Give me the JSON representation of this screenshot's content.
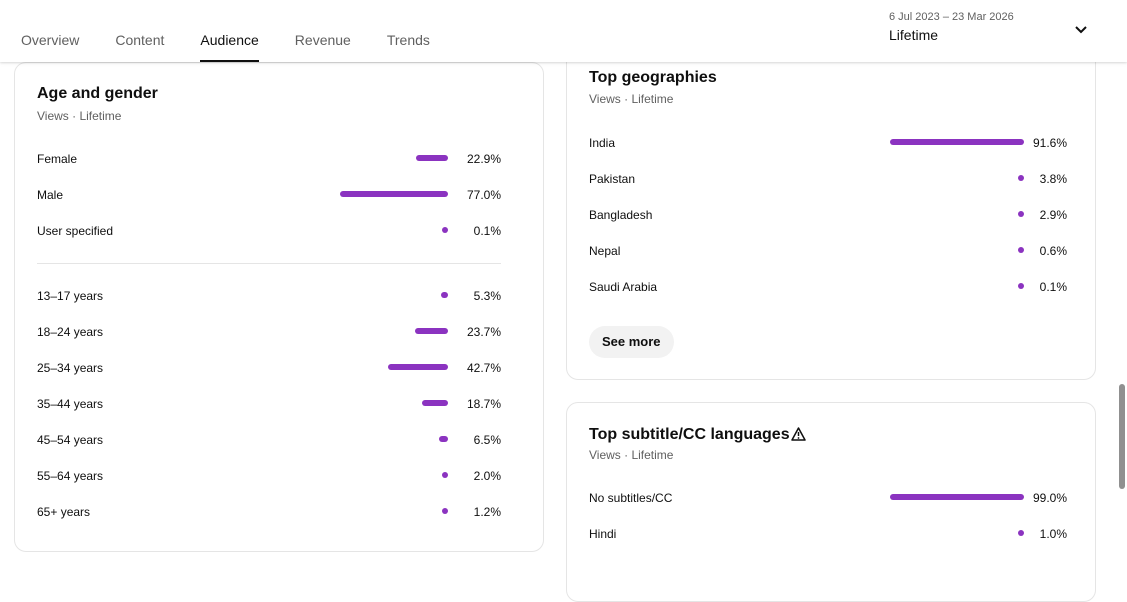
{
  "tabs": [
    {
      "label": "Overview"
    },
    {
      "label": "Content"
    },
    {
      "label": "Audience"
    },
    {
      "label": "Revenue"
    },
    {
      "label": "Trends"
    }
  ],
  "active_tab": "Audience",
  "date_range": {
    "range": "6 Jul 2023 – 23 Mar 2026",
    "period": "Lifetime"
  },
  "colors": {
    "bar": "#8b33c0"
  },
  "age_gender": {
    "title": "Age and gender",
    "subtitle": "Views · Lifetime",
    "gender": [
      {
        "label": "Female",
        "value": "22.9%",
        "pct": 22.9
      },
      {
        "label": "Male",
        "value": "77.0%",
        "pct": 77.0
      },
      {
        "label": "User specified",
        "value": "0.1%",
        "pct": 0.1
      }
    ],
    "ages": [
      {
        "label": "13–17 years",
        "value": "5.3%",
        "pct": 5.3
      },
      {
        "label": "18–24 years",
        "value": "23.7%",
        "pct": 23.7
      },
      {
        "label": "25–34 years",
        "value": "42.7%",
        "pct": 42.7
      },
      {
        "label": "35–44 years",
        "value": "18.7%",
        "pct": 18.7
      },
      {
        "label": "45–54 years",
        "value": "6.5%",
        "pct": 6.5
      },
      {
        "label": "55–64 years",
        "value": "2.0%",
        "pct": 2.0
      },
      {
        "label": "65+ years",
        "value": "1.2%",
        "pct": 1.2
      }
    ]
  },
  "geographies": {
    "title": "Top geographies",
    "subtitle": "Views · Lifetime",
    "rows": [
      {
        "label": "India",
        "value": "91.6%",
        "pct": 91.6
      },
      {
        "label": "Pakistan",
        "value": "3.8%",
        "pct": 3.8
      },
      {
        "label": "Bangladesh",
        "value": "2.9%",
        "pct": 2.9
      },
      {
        "label": "Nepal",
        "value": "0.6%",
        "pct": 0.6
      },
      {
        "label": "Saudi Arabia",
        "value": "0.1%",
        "pct": 0.1
      }
    ],
    "see_more": "See more"
  },
  "subtitles": {
    "title": "Top subtitle/CC languages",
    "subtitle": "Views · Lifetime",
    "rows": [
      {
        "label": "No subtitles/CC",
        "value": "99.0%",
        "pct": 99.0
      },
      {
        "label": "Hindi",
        "value": "1.0%",
        "pct": 1.0
      }
    ],
    "icon": "warning-icon"
  }
}
